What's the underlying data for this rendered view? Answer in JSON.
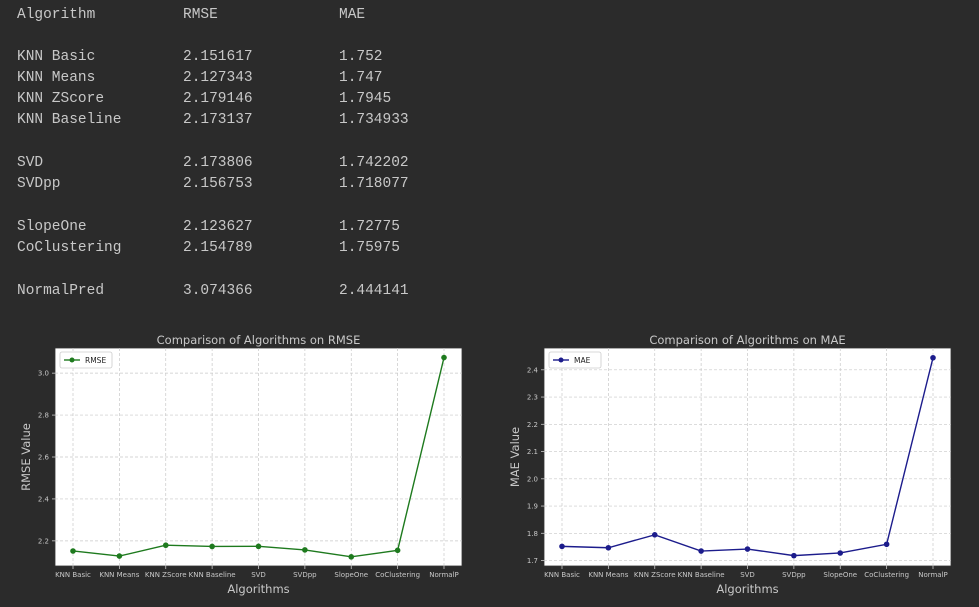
{
  "table": {
    "headers": [
      "Algorithm",
      "RMSE",
      "MAE"
    ],
    "rows": [
      {
        "name": "KNN Basic",
        "rmse": "2.151617",
        "mae": "1.752"
      },
      {
        "name": "KNN Means",
        "rmse": "2.127343",
        "mae": "1.747"
      },
      {
        "name": "KNN ZScore",
        "rmse": "2.179146",
        "mae": "1.7945"
      },
      {
        "name": "KNN Baseline",
        "rmse": "2.173137",
        "mae": "1.734933"
      },
      {
        "name": "SVD",
        "rmse": "2.173806",
        "mae": "1.742202"
      },
      {
        "name": "SVDpp",
        "rmse": "2.156753",
        "mae": "1.718077"
      },
      {
        "name": "SlopeOne",
        "rmse": "2.123627",
        "mae": "1.72775"
      },
      {
        "name": "CoClustering",
        "rmse": "2.154789",
        "mae": "1.75975"
      },
      {
        "name": "NormalPred",
        "rmse": "3.074366",
        "mae": "2.444141"
      }
    ]
  },
  "colors": {
    "background": "#2b2b2b",
    "text": "#c8c8c8",
    "plot_bg": "#ffffff",
    "rmse_line": "#1e7a1e",
    "mae_line": "#1c1c8c",
    "grid": "#c8c8c8"
  },
  "chart_data": [
    {
      "type": "line",
      "title": "Comparison of Algorithms on RMSE",
      "xlabel": "Algorithms",
      "ylabel": "RMSE Value",
      "categories": [
        "KNN Basic",
        "KNN Means",
        "KNN ZScore",
        "KNN Baseline",
        "SVD",
        "SVDpp",
        "SlopeOne",
        "CoClustering",
        "NormalPred"
      ],
      "tick_labels": [
        "KNN Basic",
        "KNN Means",
        "KNN ZScore",
        "KNN Baseline",
        "SVD",
        "SVDpp",
        "SlopeOne",
        "CoClustering",
        "NormalP"
      ],
      "series": [
        {
          "name": "RMSE",
          "values": [
            2.151617,
            2.127343,
            2.179146,
            2.173137,
            2.173806,
            2.156753,
            2.123627,
            2.154789,
            3.074366
          ],
          "color": "#1e7a1e"
        }
      ],
      "ylim": [
        2.08,
        3.12
      ],
      "yticks": [
        2.2,
        2.4,
        2.6,
        2.8,
        3.0
      ],
      "ytick_labels": [
        "2.2",
        "2.4",
        "2.6",
        "2.8",
        "3.0"
      ],
      "grid": true,
      "legend": "top-left"
    },
    {
      "type": "line",
      "title": "Comparison of Algorithms on MAE",
      "xlabel": "Algorithms",
      "ylabel": "MAE Value",
      "categories": [
        "KNN Basic",
        "KNN Means",
        "KNN ZScore",
        "KNN Baseline",
        "SVD",
        "SVDpp",
        "SlopeOne",
        "CoClustering",
        "NormalPred"
      ],
      "tick_labels": [
        "KNN Basic",
        "KNN Means",
        "KNN ZScore",
        "KNN Baseline",
        "SVD",
        "SVDpp",
        "SlopeOne",
        "CoClustering",
        "NormalP"
      ],
      "series": [
        {
          "name": "MAE",
          "values": [
            1.752,
            1.747,
            1.7945,
            1.734933,
            1.742202,
            1.718077,
            1.72775,
            1.75975,
            2.444141
          ],
          "color": "#1c1c8c"
        }
      ],
      "ylim": [
        1.68,
        2.48
      ],
      "yticks": [
        1.7,
        1.8,
        1.9,
        2.0,
        2.1,
        2.2,
        2.3,
        2.4
      ],
      "ytick_labels": [
        "1.7",
        "1.8",
        "1.9",
        "2.0",
        "2.1",
        "2.2",
        "2.3",
        "2.4"
      ],
      "grid": true,
      "legend": "top-left"
    }
  ]
}
